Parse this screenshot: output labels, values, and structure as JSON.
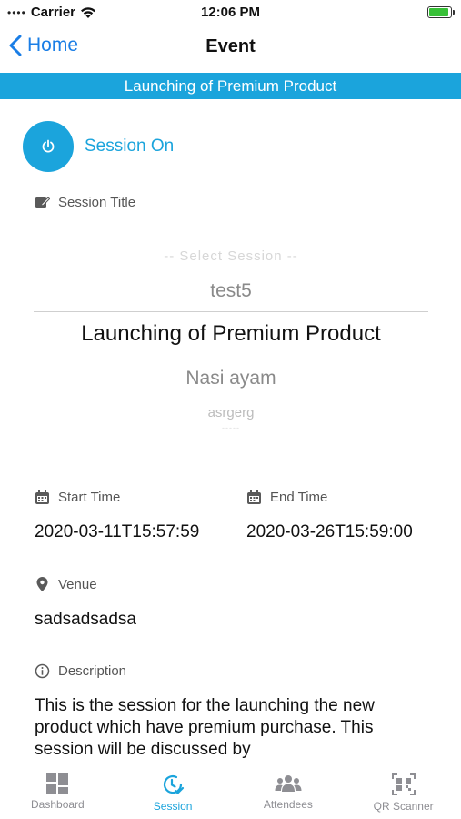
{
  "status_bar": {
    "carrier": "Carrier",
    "time": "12:06 PM"
  },
  "nav": {
    "back_label": "Home",
    "title": "Event"
  },
  "banner": {
    "text": "Launching of Premium Product"
  },
  "session_toggle": {
    "label": "Session On"
  },
  "session_title": {
    "label": "Session Title",
    "picker": {
      "options": [
        "-- Select Session --",
        "test5",
        "Launching of Premium Product",
        "Nasi ayam",
        "asrgerg",
        "-----"
      ],
      "selected": "Launching of Premium Product"
    }
  },
  "start_time": {
    "label": "Start Time",
    "value": "2020-03-11T15:57:59"
  },
  "end_time": {
    "label": "End Time",
    "value": "2020-03-26T15:59:00"
  },
  "venue": {
    "label": "Venue",
    "value": "sadsadsadsa"
  },
  "description": {
    "label": "Description",
    "value": "This is the session for the launching the new product which have premium purchase. This session will be discussed by"
  },
  "tabs": [
    {
      "label": "Dashboard",
      "icon": "dashboard-icon",
      "active": false
    },
    {
      "label": "Session",
      "icon": "session-clock-icon",
      "active": true
    },
    {
      "label": "Attendees",
      "icon": "attendees-icon",
      "active": false
    },
    {
      "label": "QR Scanner",
      "icon": "qr-scanner-icon",
      "active": false
    }
  ],
  "colors": {
    "accent": "#1ba4dc",
    "nav_link": "#1a7ee6",
    "tab_inactive": "#8e8e93"
  }
}
